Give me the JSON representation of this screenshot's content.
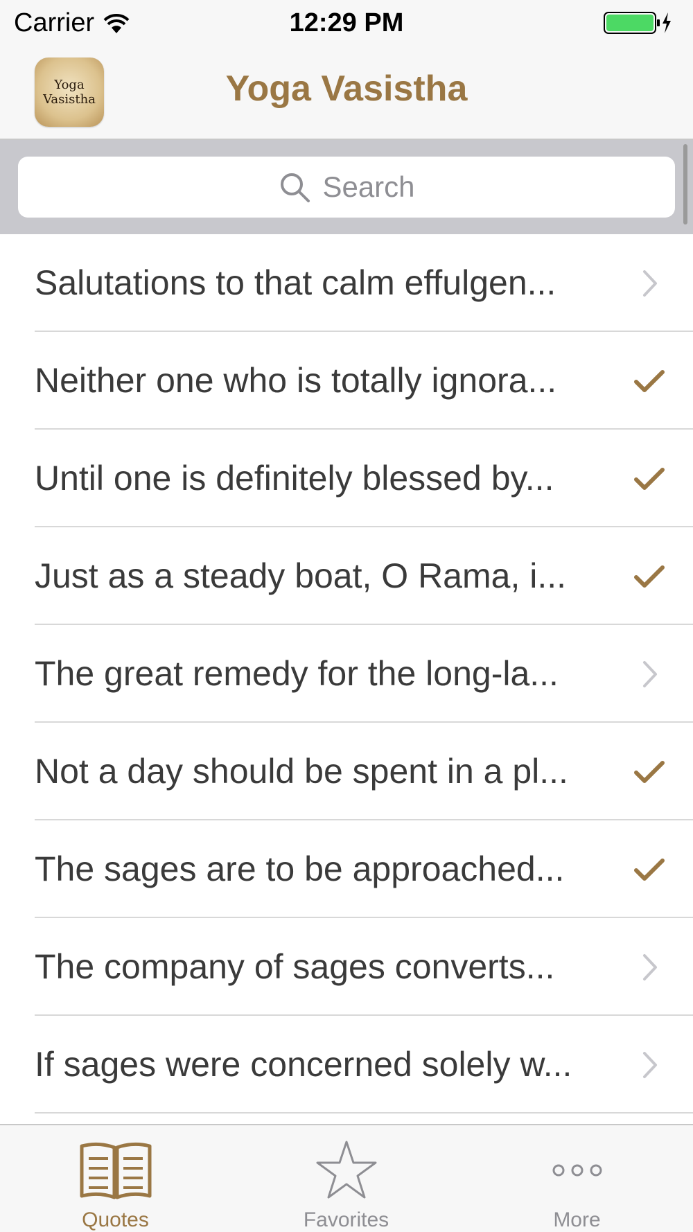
{
  "status_bar": {
    "carrier": "Carrier",
    "time": "12:29 PM"
  },
  "nav": {
    "logo_line1": "Yoga",
    "logo_line2": "Vasistha",
    "title": "Yoga Vasistha"
  },
  "search": {
    "placeholder": "Search"
  },
  "colors": {
    "accent": "#9a7744",
    "battery": "#4cd964"
  },
  "quotes": [
    {
      "text": "Salutations to that calm effulgen...",
      "accessory": "chevron"
    },
    {
      "text": "Neither one who is totally ignora...",
      "accessory": "checkmark"
    },
    {
      "text": "Until one is definitely blessed by...",
      "accessory": "checkmark"
    },
    {
      "text": "Just as a steady boat, O Rama, i...",
      "accessory": "checkmark"
    },
    {
      "text": "The great remedy for the long-la...",
      "accessory": "chevron"
    },
    {
      "text": "Not a day should be spent in a pl...",
      "accessory": "checkmark"
    },
    {
      "text": "The sages are to be approached...",
      "accessory": "checkmark"
    },
    {
      "text": "The company of sages converts...",
      "accessory": "chevron"
    },
    {
      "text": "If sages were concerned solely w...",
      "accessory": "chevron"
    }
  ],
  "tabs": [
    {
      "label": "Quotes",
      "icon": "book-icon",
      "active": true
    },
    {
      "label": "Favorites",
      "icon": "star-icon",
      "active": false
    },
    {
      "label": "More",
      "icon": "more-icon",
      "active": false
    }
  ]
}
